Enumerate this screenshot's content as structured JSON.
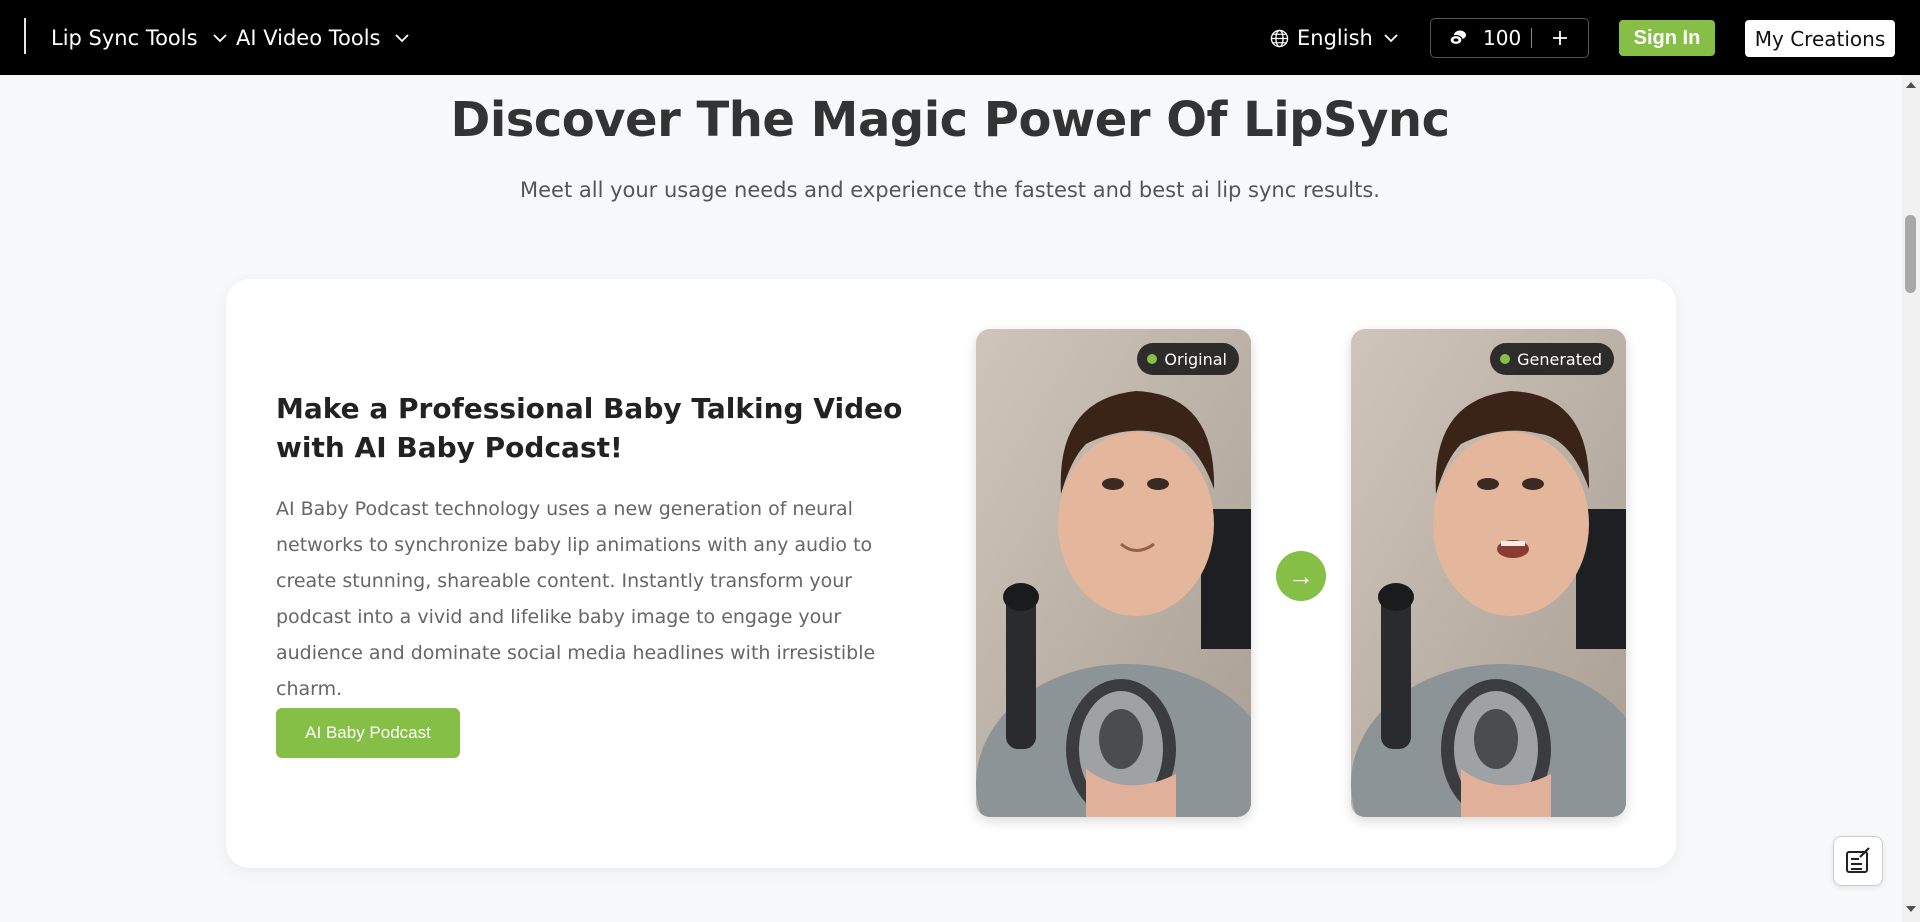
{
  "header": {
    "nav": [
      {
        "label": "Lip Sync Tools",
        "icon": "chevron-down-icon"
      },
      {
        "label": "AI Video Tools",
        "icon": "chevron-down-icon"
      }
    ],
    "language": {
      "label": "English",
      "icon": "globe-icon"
    },
    "credits": {
      "count": "100",
      "icon": "coins-icon",
      "add_icon": "plus-icon"
    },
    "sign_in_label": "Sign In",
    "my_creations_label": "My Creations"
  },
  "section": {
    "title": "Discover The Magic Power Of LipSync",
    "subtitle": "Meet all your usage needs and experience the fastest and best ai lip sync results."
  },
  "card": {
    "title": "Make a Professional Baby Talking Video with AI Baby Podcast!",
    "description": "AI Baby Podcast technology uses a new generation of neural networks to synchronize baby lip animations with any audio to create stunning, shareable content. Instantly transform your podcast into a vivid and lifelike baby image to engage your audience and dominate social media headlines with irresistible charm.",
    "button_label": "AI Baby Podcast",
    "original_label": "Original",
    "generated_label": "Generated",
    "arrow": "→"
  },
  "colors": {
    "accent": "#85bf45",
    "header_bg": "#000000",
    "page_bg": "#f7f8fa"
  }
}
